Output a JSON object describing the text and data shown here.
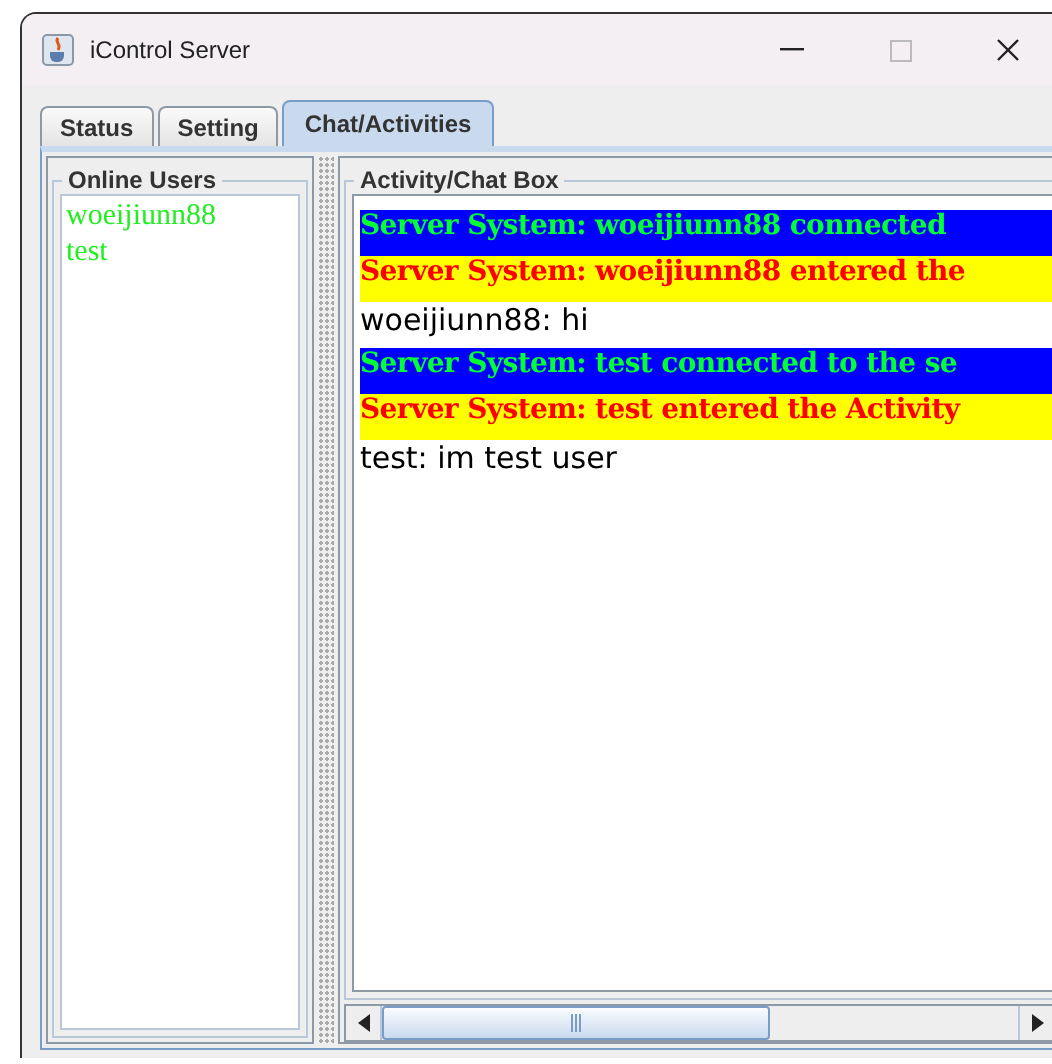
{
  "window": {
    "title": "iControl Server"
  },
  "tabs": [
    {
      "label": "Status",
      "selected": false
    },
    {
      "label": "Setting",
      "selected": false
    },
    {
      "label": "Chat/Activities",
      "selected": true
    }
  ],
  "online_users": {
    "title": "Online Users",
    "users": [
      "woeijiunn88",
      "test"
    ]
  },
  "chat_box": {
    "title": "Activity/Chat Box",
    "messages": [
      {
        "kind": "connect",
        "text": "Server System: woeijiunn88 connected"
      },
      {
        "kind": "enter",
        "text": "Server System: woeijiunn88 entered the"
      },
      {
        "kind": "chat",
        "text": "woeijiunn88: hi"
      },
      {
        "kind": "connect",
        "text": "Server System: test connected to the se"
      },
      {
        "kind": "enter",
        "text": "Server System: test entered the Activity"
      },
      {
        "kind": "chat",
        "text": "test: im test user"
      }
    ]
  }
}
